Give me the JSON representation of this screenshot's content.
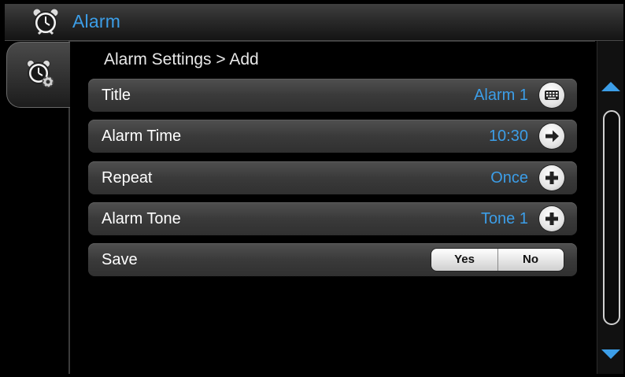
{
  "app": {
    "title": "Alarm",
    "icon": "alarm-clock-icon",
    "accent_color": "#3c9ee8"
  },
  "sidebar": {
    "active_tab_icon": "alarm-settings-icon"
  },
  "main": {
    "breadcrumb": "Alarm Settings > Add",
    "rows": [
      {
        "label": "Title",
        "value": "Alarm 1",
        "icon": "keyboard-icon"
      },
      {
        "label": "Alarm Time",
        "value": "10:30",
        "icon": "arrow-right-icon"
      },
      {
        "label": "Repeat",
        "value": "Once",
        "icon": "plus-icon"
      },
      {
        "label": "Alarm Tone",
        "value": "Tone 1",
        "icon": "plus-icon"
      }
    ],
    "save": {
      "label": "Save",
      "yes_label": "Yes",
      "no_label": "No"
    }
  },
  "scrollbar": {
    "up_icon": "scroll-up-icon",
    "down_icon": "scroll-down-icon"
  }
}
